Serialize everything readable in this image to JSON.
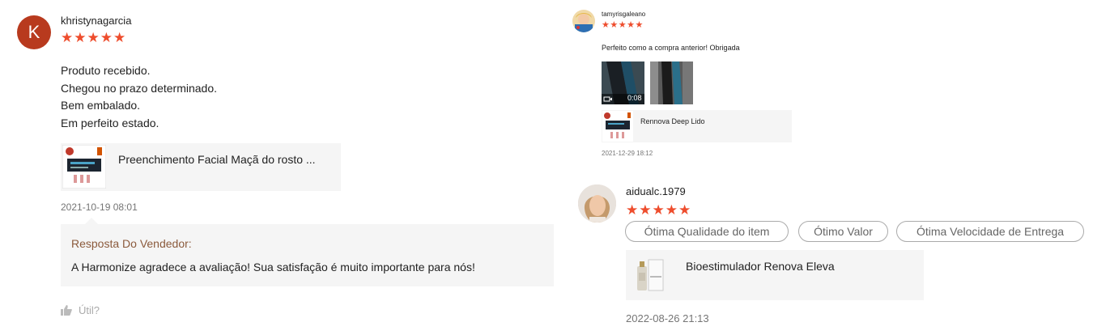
{
  "review1": {
    "avatar_letter": "K",
    "avatar_color": "#b83a1e",
    "username": "khristynagarcia",
    "stars": "★★★★★",
    "body": [
      "Produto recebido.",
      "Chegou no prazo determinado.",
      "Bem embalado.",
      "Em perfeito estado."
    ],
    "product_name": "Preenchimento Facial Maçã do rosto ...",
    "date": "2021-10-19 08:01",
    "reply_title": "Resposta Do Vendedor:",
    "reply_text": "A Harmonize agradece a avaliação! Sua satisfação é muito importante para nós!",
    "useful_label": "Útil?"
  },
  "review2": {
    "username": "tamyrisgaleano",
    "stars": "★★★★★",
    "body": "Perfeito como a compra anterior! Obrigada",
    "video_duration": "0:08",
    "product_name": "Rennova Deep Lido",
    "date": "2021-12-29 18:12"
  },
  "review3": {
    "username": "aidualc.1979",
    "stars": "★★★★★",
    "tags": [
      "Ótima Qualidade do item",
      "Ótimo Valor",
      "Ótima Velocidade de Entrega"
    ],
    "product_name": "Bioestimulador Renova Eleva",
    "date": "2022-08-26 21:13"
  },
  "colors": {
    "star": "#ee4d2d",
    "reply_title": "#8b5a3c",
    "panel_bg": "#f5f5f5"
  }
}
